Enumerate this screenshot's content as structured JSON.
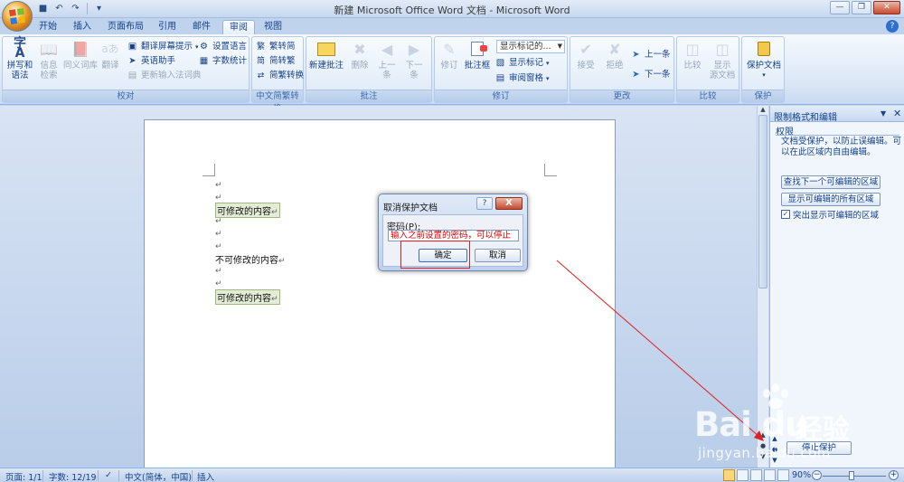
{
  "window": {
    "title": "新建 Microsoft Office Word 文档 - Microsoft Word"
  },
  "ribbon_tabs": [
    "开始",
    "插入",
    "页面布局",
    "引用",
    "邮件",
    "审阅",
    "视图"
  ],
  "active_tab": "审阅",
  "groups": {
    "proofing": {
      "label": "校对",
      "spelling": "拼写和\n语法",
      "research": "信息\n检索",
      "thesaurus": "同义词库",
      "translate": "翻译",
      "translate_tip": "翻译屏幕提示",
      "set_language": "设置语言",
      "english_assist": "英语助手",
      "word_count": "字数统计",
      "update_ime": "更新输入法词典"
    },
    "chinese_convert": {
      "label": "中文简繁转换",
      "to_simplified": "繁转简",
      "to_traditional": "简转繁",
      "convert": "简繁转换"
    },
    "comments": {
      "label": "批注",
      "new_comment": "新建批注",
      "delete": "删除",
      "previous": "上一\n条",
      "next": "下一\n条"
    },
    "tracking": {
      "label": "修订",
      "track_changes": "修订",
      "balloons": "批注框",
      "display_combo": "显示标记的...",
      "show_markup": "显示标记",
      "reviewing_pane": "审阅窗格"
    },
    "changes": {
      "label": "更改",
      "accept": "接受",
      "reject": "拒绝",
      "previous": "上一条",
      "next": "下一条"
    },
    "compare": {
      "label": "比较",
      "compare": "比较",
      "show_source": "显示\n源文档"
    },
    "protect": {
      "label": "保护",
      "protect_document": "保护文档"
    }
  },
  "document": {
    "lines": [
      {
        "text": "",
        "kind": "mark"
      },
      {
        "text": "",
        "kind": "mark"
      },
      {
        "text": "可修改的内容",
        "kind": "editable"
      },
      {
        "text": "",
        "kind": "mark"
      },
      {
        "text": "",
        "kind": "mark"
      },
      {
        "text": "",
        "kind": "mark"
      },
      {
        "text": "不可修改的内容",
        "kind": "plain"
      },
      {
        "text": "",
        "kind": "mark"
      },
      {
        "text": "",
        "kind": "mark"
      },
      {
        "text": "可修改的内容",
        "kind": "editable"
      }
    ],
    "paragraph_mark": "↵"
  },
  "dialog": {
    "title": "取消保护文档",
    "password_label": "密码(P):",
    "password_value": "输入之前设置的密码，可以停止",
    "ok": "确定",
    "cancel": "取消",
    "help": "?",
    "close": "X"
  },
  "task_pane": {
    "title": "限制格式和编辑",
    "section": "权限",
    "note": "文档受保护，以防止误编辑。可以在此区域内自由编辑。",
    "find_next": "查找下一个可编辑的区域",
    "show_all": "显示可编辑的所有区域",
    "highlight": "突出显示可编辑的区域",
    "highlight_checked": true,
    "stop_protection": "停止保护"
  },
  "statusbar": {
    "page": "页面: 1/1",
    "words": "字数: 12/19",
    "language": "中文(简体，中国)",
    "mode": "插入",
    "zoom": "90%"
  },
  "watermark": {
    "logo": "Bai du",
    "cn": "经验",
    "url": "jingyan.baidu.com"
  },
  "colors": {
    "accent": "#15428b",
    "editable_bg": "#e3ecd6",
    "annotation_red": "#e02020"
  }
}
